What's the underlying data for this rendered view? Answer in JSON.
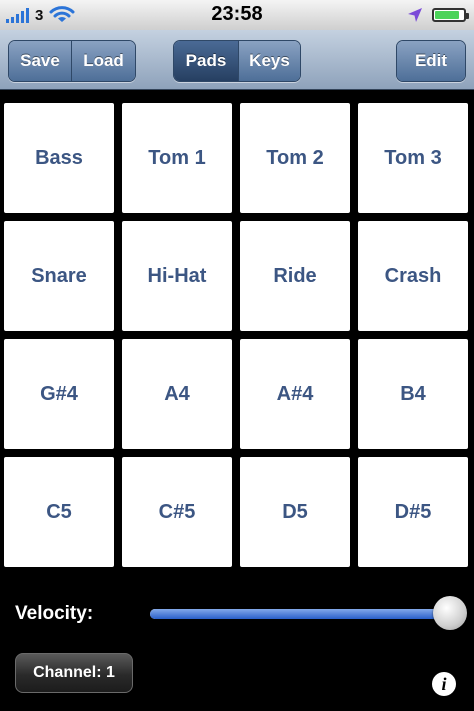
{
  "status_bar": {
    "carrier": "3",
    "time": "23:58",
    "signal_bars": 5,
    "icons": [
      "signal-bars-icon",
      "wifi-icon",
      "location-arrow-icon",
      "battery-icon"
    ],
    "battery_level": 0.85
  },
  "toolbar": {
    "save_label": "Save",
    "load_label": "Load",
    "pads_label": "Pads",
    "keys_label": "Keys",
    "edit_label": "Edit",
    "selected_mode": "Pads"
  },
  "pads": [
    {
      "label": "Bass"
    },
    {
      "label": "Tom 1"
    },
    {
      "label": "Tom 2"
    },
    {
      "label": "Tom 3"
    },
    {
      "label": "Snare"
    },
    {
      "label": "Hi-Hat"
    },
    {
      "label": "Ride"
    },
    {
      "label": "Crash"
    },
    {
      "label": "G#4"
    },
    {
      "label": "A4"
    },
    {
      "label": "A#4"
    },
    {
      "label": "B4"
    },
    {
      "label": "C5"
    },
    {
      "label": "C#5"
    },
    {
      "label": "D5"
    },
    {
      "label": "D#5"
    }
  ],
  "velocity": {
    "label": "Velocity:",
    "value": 1.0
  },
  "channel": {
    "label": "Channel: 1"
  },
  "info_icon": "info-icon",
  "colors": {
    "pad_text": "#3c5683",
    "toolbar_button": "#5d7ea8",
    "slider_fill": "#2a5fc9",
    "signal": "#2b74d8",
    "location": "#7b4bd8",
    "battery": "#4cd35a"
  }
}
